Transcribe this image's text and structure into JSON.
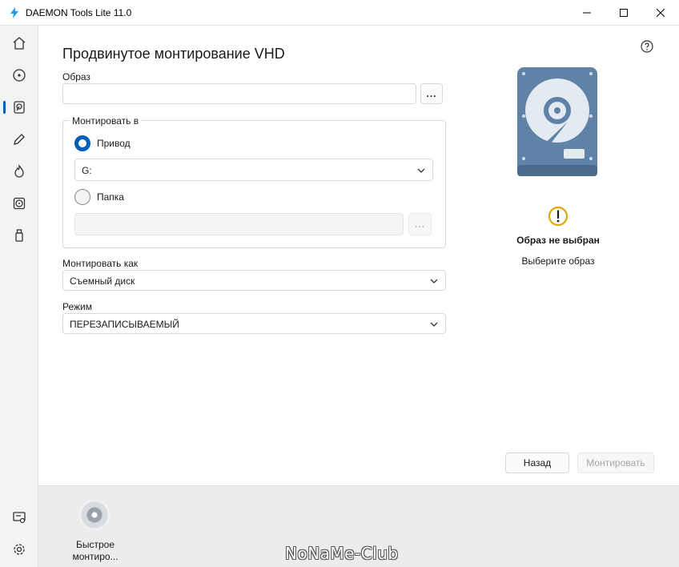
{
  "window": {
    "title": "DAEMON Tools Lite 11.0",
    "controls": {
      "minimize": "—",
      "maximize": "☐",
      "close": "✕"
    }
  },
  "rail": {
    "items": [
      {
        "icon": "home-icon"
      },
      {
        "icon": "disc-icon"
      },
      {
        "icon": "hdd-mount-icon",
        "active": true
      },
      {
        "icon": "pencil-icon"
      },
      {
        "icon": "flame-icon"
      },
      {
        "icon": "disc-image-icon"
      },
      {
        "icon": "usb-icon"
      }
    ],
    "bottom_items": [
      {
        "icon": "license-icon"
      },
      {
        "icon": "settings-icon"
      }
    ]
  },
  "main": {
    "title": "Продвинутое монтирование VHD",
    "image_label": "Образ",
    "image_value": "",
    "browse_label": "...",
    "mount_to": {
      "caption": "Монтировать в",
      "drive_option": "Привод",
      "drive_value": "G:",
      "folder_option": "Папка",
      "folder_value": "",
      "folder_browse_label": "..."
    },
    "mount_as": {
      "label": "Монтировать как",
      "value": "Съемный диск"
    },
    "mode": {
      "label": "Режим",
      "value": "ПЕРЕЗАПИСЫВАЕМЫЙ"
    },
    "status": {
      "title": "Образ не выбран",
      "subtitle": "Выберите образ"
    },
    "back_button": "Назад",
    "mount_button": "Монтировать"
  },
  "bottom": {
    "quick_mount_label": "Быстрое монтиро...",
    "watermark": "NoNaMe-Club"
  },
  "colors": {
    "accent": "#005fb8",
    "warning": "#e0a800",
    "disk_body": "#6a8caf"
  }
}
